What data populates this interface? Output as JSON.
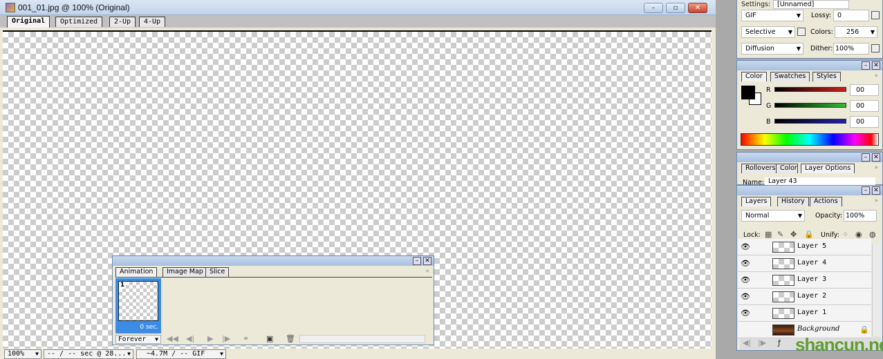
{
  "document": {
    "title": "001_01.jpg @ 100% (Original)",
    "window_buttons": {
      "minimize": "–",
      "restore": "▫",
      "close": "✕"
    },
    "view_tabs": [
      {
        "label": "Original",
        "active": true
      },
      {
        "label": "Optimized"
      },
      {
        "label": "2-Up"
      },
      {
        "label": "4-Up"
      }
    ],
    "status": {
      "zoom": "100%",
      "timing": "-- / -- sec @ 28...",
      "size": "~4.7M / -- GIF"
    }
  },
  "optimize_panel": {
    "settings_label": "Settings:",
    "settings_value": "[Unnamed]",
    "format": "GIF",
    "lossy_label": "Lossy:",
    "lossy_value": "0",
    "reduction": "Selective",
    "colors_label": "Colors:",
    "colors_value": "256",
    "dither_method": "Diffusion",
    "dither_label": "Dither:",
    "dither_value": "100%"
  },
  "color_panel": {
    "tabs": [
      {
        "label": "Color",
        "active": true
      },
      {
        "label": "Swatches"
      },
      {
        "label": "Styles"
      }
    ],
    "channels": [
      {
        "label": "R",
        "value": "00",
        "color": "#cc2020"
      },
      {
        "label": "G",
        "value": "00",
        "color": "#30c030"
      },
      {
        "label": "B",
        "value": "00",
        "color": "#2020b0"
      }
    ],
    "foreground": "#000000",
    "background": "#ffffff"
  },
  "layer_options_panel": {
    "tabs": [
      {
        "label": "Rollovers"
      },
      {
        "label": "Color Ta"
      },
      {
        "label": "Layer Options",
        "active": true
      }
    ],
    "name_label": "Name:",
    "name_value": "Layer 43"
  },
  "layers_panel": {
    "tabs": [
      {
        "label": "Layers",
        "active": true
      },
      {
        "label": "History"
      },
      {
        "label": "Actions"
      }
    ],
    "blend_mode": "Normal",
    "opacity_label": "Opacity:",
    "opacity_value": "100%",
    "lock_label": "Lock:",
    "unify_label": "Unify:",
    "layers": [
      {
        "name": "Layer 5",
        "visible": true
      },
      {
        "name": "Layer 4",
        "visible": true
      },
      {
        "name": "Layer 3",
        "visible": true
      },
      {
        "name": "Layer 2",
        "visible": true
      },
      {
        "name": "Layer 1",
        "visible": true
      },
      {
        "name": "Background",
        "visible": false,
        "locked": true
      }
    ]
  },
  "animation_panel": {
    "tabs": [
      {
        "label": "Animation",
        "active": true
      },
      {
        "label": "Image Map"
      },
      {
        "label": "Slice"
      }
    ],
    "frames": [
      {
        "number": "1",
        "delay": "0 sec."
      }
    ],
    "loop": "Forever",
    "accent": "#3c8ce6"
  },
  "watermark": "shancun.net"
}
